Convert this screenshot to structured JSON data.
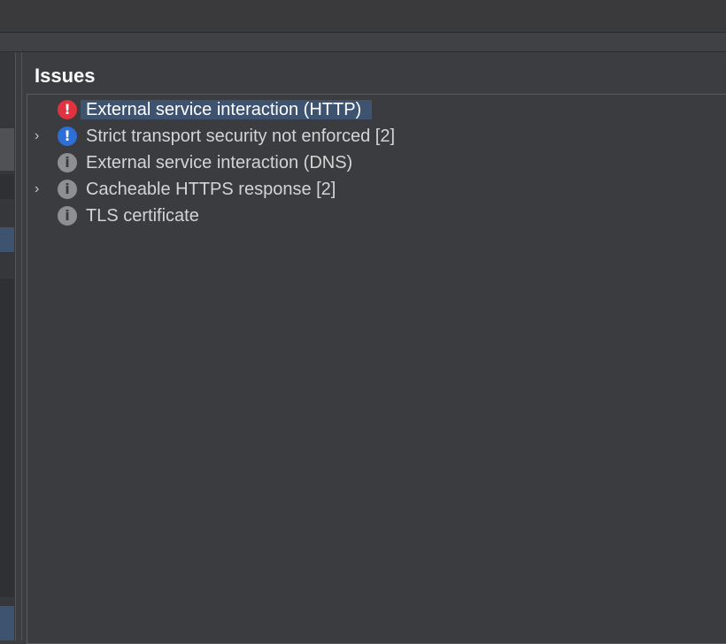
{
  "panel": {
    "title": "Issues"
  },
  "issues": [
    {
      "label": "External service interaction (HTTP)",
      "severity": "high",
      "icon": "exclamation-icon",
      "expandable": false,
      "selected": true
    },
    {
      "label": "Strict transport security not enforced [2]",
      "severity": "low",
      "icon": "exclamation-icon",
      "expandable": true,
      "selected": false
    },
    {
      "label": "External service interaction (DNS)",
      "severity": "info",
      "icon": "info-icon",
      "expandable": false,
      "selected": false
    },
    {
      "label": "Cacheable HTTPS response [2]",
      "severity": "info",
      "icon": "info-icon",
      "expandable": true,
      "selected": false
    },
    {
      "label": "TLS certificate",
      "severity": "info",
      "icon": "info-icon",
      "expandable": false,
      "selected": false
    }
  ],
  "colors": {
    "high": "#e0323f",
    "low": "#2d6fd6",
    "info": "#8e8f93",
    "selection": "#3d5370"
  }
}
